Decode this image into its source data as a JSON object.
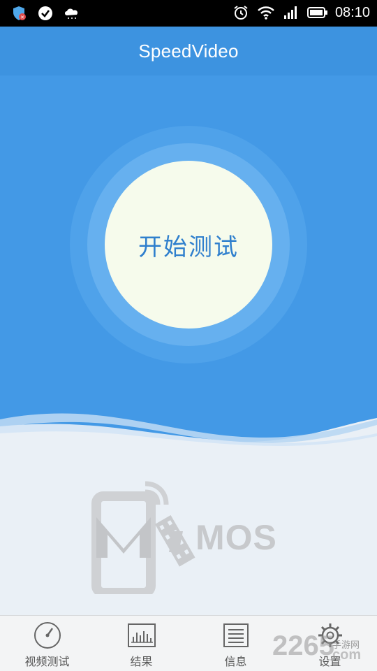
{
  "status_bar": {
    "time": "08:10",
    "left_icons": [
      "shield-badge-icon",
      "check-circle-icon",
      "cloud-icon"
    ],
    "right_icons": [
      "alarm-icon",
      "wifi-icon",
      "signal-icon",
      "battery-icon"
    ]
  },
  "header": {
    "title": "SpeedVideo"
  },
  "hero": {
    "start_label": "开始测试"
  },
  "logo": {
    "text": "MOS"
  },
  "tabs": [
    {
      "label": "视频测试",
      "icon": "speedometer-icon"
    },
    {
      "label": "结果",
      "icon": "bar-chart-icon"
    },
    {
      "label": "信息",
      "icon": "document-icon"
    },
    {
      "label": "设置",
      "icon": "gear-icon"
    }
  ],
  "watermark": {
    "number": "2265",
    "site": "手游网",
    "domain": "com"
  },
  "colors": {
    "header_blue": "#3d93e0",
    "hero_blue": "#4399e6",
    "circle_fill": "#f6fbec",
    "start_text": "#2f7fcd",
    "page_bg": "#eaf0f6"
  }
}
